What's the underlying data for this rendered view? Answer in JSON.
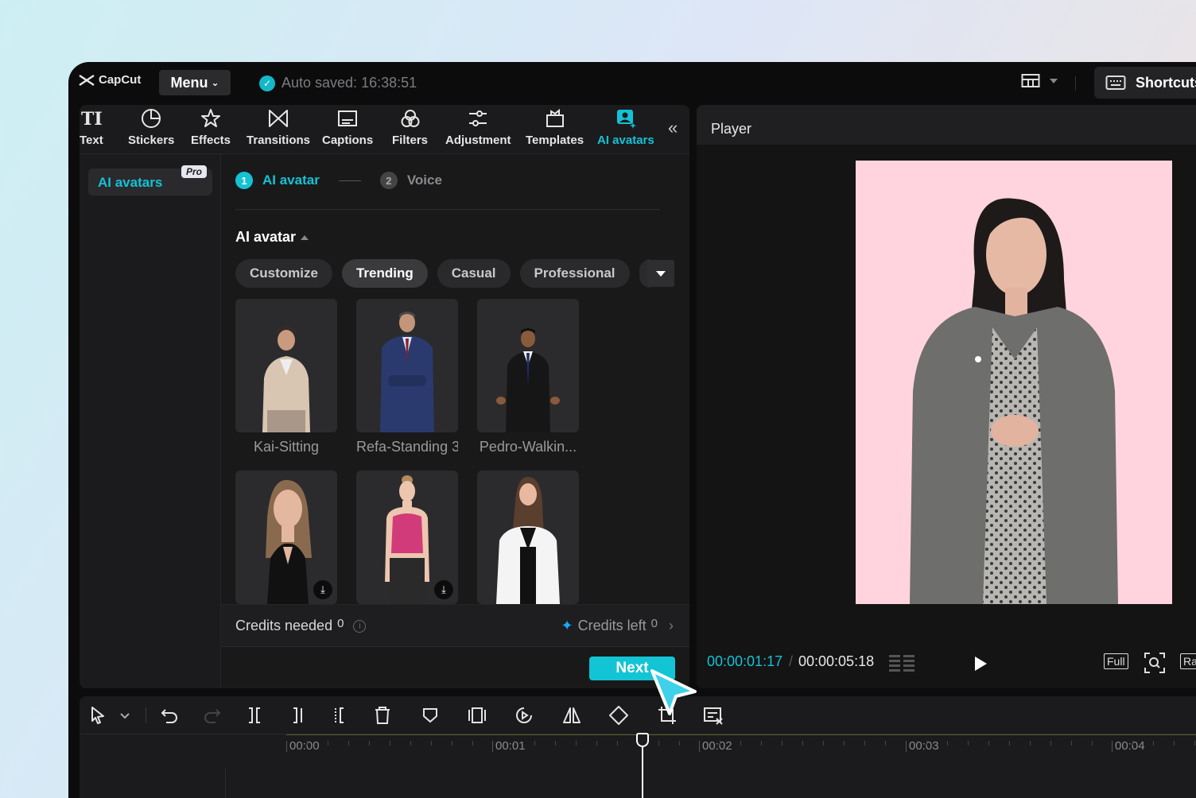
{
  "app": {
    "name": "CapCut",
    "menu_label": "Menu",
    "autosave_text": "Auto saved: 16:38:51",
    "shortcut_label": "Shortcuts"
  },
  "toolbar": {
    "tools": [
      {
        "label": "Text",
        "icon": "text-icon"
      },
      {
        "label": "Stickers",
        "icon": "sticker-icon"
      },
      {
        "label": "Effects",
        "icon": "effects-star-icon"
      },
      {
        "label": "Transitions",
        "icon": "transition-bowtie-icon"
      },
      {
        "label": "Captions",
        "icon": "captions-icon"
      },
      {
        "label": "Filters",
        "icon": "filters-icon"
      },
      {
        "label": "Adjustment",
        "icon": "adjustment-sliders-icon"
      },
      {
        "label": "Templates",
        "icon": "templates-icon"
      },
      {
        "label": "AI avatars",
        "icon": "ai-avatar-icon",
        "active": true
      }
    ]
  },
  "sidenav": {
    "item_label": "AI avatars",
    "badge": "Pro"
  },
  "steps": {
    "step1_num": "1",
    "step1_label": "AI avatar",
    "step2_num": "2",
    "step2_label": "Voice"
  },
  "section": {
    "title": "AI avatar"
  },
  "chips": [
    "Customize",
    "Trending",
    "Casual",
    "Professional"
  ],
  "active_chip": "Trending",
  "avatars": [
    {
      "name": "Kai-Sitting"
    },
    {
      "name": "Refa-Standing 3"
    },
    {
      "name": "Pedro-Walkin..."
    },
    {
      "name": "",
      "downloadable": true
    },
    {
      "name": "",
      "downloadable": true
    },
    {
      "name": ""
    }
  ],
  "credits": {
    "needed_label": "Credits needed",
    "needed_value": "0",
    "left_label": "Credits left",
    "left_value": "0"
  },
  "next_label": "Next",
  "player": {
    "title": "Player",
    "current_time": "00:00:01:17",
    "total_time": "00:00:05:18",
    "full_label": "Full",
    "ratio_label": "Ra"
  },
  "timeline": {
    "ticks": [
      "00:00",
      "00:01",
      "00:02",
      "00:03",
      "00:04"
    ]
  },
  "colors": {
    "accent": "#14c2d6",
    "preview_bg": "#ffd4de",
    "window_bg": "#0c0c0d",
    "panel_bg": "#1b1b1d"
  }
}
